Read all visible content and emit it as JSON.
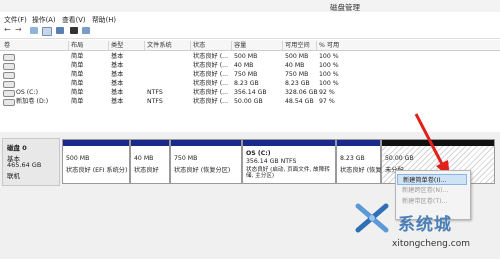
{
  "window": {
    "title": "磁盘管理"
  },
  "menu": [
    {
      "label": "文件(F)"
    },
    {
      "label": "操作(A)"
    },
    {
      "label": "查看(V)"
    },
    {
      "label": "帮助(H)"
    }
  ],
  "toolbar": {
    "icons": [
      "back-arrow-icon",
      "forward-arrow-icon",
      "view-icon",
      "help-icon",
      "properties-icon",
      "refresh-icon",
      "settings-icon"
    ]
  },
  "table": {
    "columns": [
      "卷",
      "布局",
      "类型",
      "文件系统",
      "状态",
      "容量",
      "可用空间",
      "% 可用"
    ],
    "rows": [
      {
        "volume": "",
        "layout": "简单",
        "type": "基本",
        "fs": "",
        "status": "状态良好 (...",
        "capacity": "500 MB",
        "free": "500 MB",
        "pct": "100 %"
      },
      {
        "volume": "",
        "layout": "简单",
        "type": "基本",
        "fs": "",
        "status": "状态良好 (...",
        "capacity": "40 MB",
        "free": "40 MB",
        "pct": "100 %"
      },
      {
        "volume": "",
        "layout": "简单",
        "type": "基本",
        "fs": "",
        "status": "状态良好 (...",
        "capacity": "750 MB",
        "free": "750 MB",
        "pct": "100 %"
      },
      {
        "volume": "",
        "layout": "简单",
        "type": "基本",
        "fs": "",
        "status": "状态良好 (...",
        "capacity": "8.23 GB",
        "free": "8.23 GB",
        "pct": "100 %"
      },
      {
        "volume": "OS (C:)",
        "layout": "简单",
        "type": "基本",
        "fs": "NTFS",
        "status": "状态良好 (...",
        "capacity": "356.14 GB",
        "free": "328.06 GB",
        "pct": "92 %"
      },
      {
        "volume": "新加卷 (D:)",
        "layout": "简单",
        "type": "基本",
        "fs": "NTFS",
        "status": "状态良好 (...",
        "capacity": "50.00 GB",
        "free": "48.54 GB",
        "pct": "97 %"
      }
    ]
  },
  "disk": {
    "name": "磁盘 0",
    "kind": "基本",
    "size": "465.64 GB",
    "state": "联机",
    "partitions": [
      {
        "title": "",
        "size": "500 MB",
        "status": "状态良好 (EFI 系统分)"
      },
      {
        "title": "",
        "size": "40 MB",
        "status": "状态良好"
      },
      {
        "title": "",
        "size": "750 MB",
        "status": "状态良好 (恢复分区)"
      },
      {
        "title": "OS  (C:)",
        "size": "356.14 GB NTFS",
        "status": "状态良好 (启动, 页面文件, 故障转储, 主分区)"
      },
      {
        "title": "",
        "size": "8.23 GB",
        "status": "状态良好 (恢复分区)"
      },
      {
        "title": "",
        "size": "50.00 GB",
        "status": "未分配"
      }
    ]
  },
  "context_menu": {
    "items": [
      {
        "label": "新建简单卷(I)..."
      },
      {
        "label": "新建跨区卷(N)..."
      },
      {
        "label": "新建带区卷(T)..."
      }
    ]
  },
  "watermark": {
    "name": "系统城",
    "url": "xitongcheng.com"
  },
  "colors": {
    "partition_bar": "#1a2a8a",
    "arrow": "#e0201a",
    "selection": "#cfe3f7"
  }
}
